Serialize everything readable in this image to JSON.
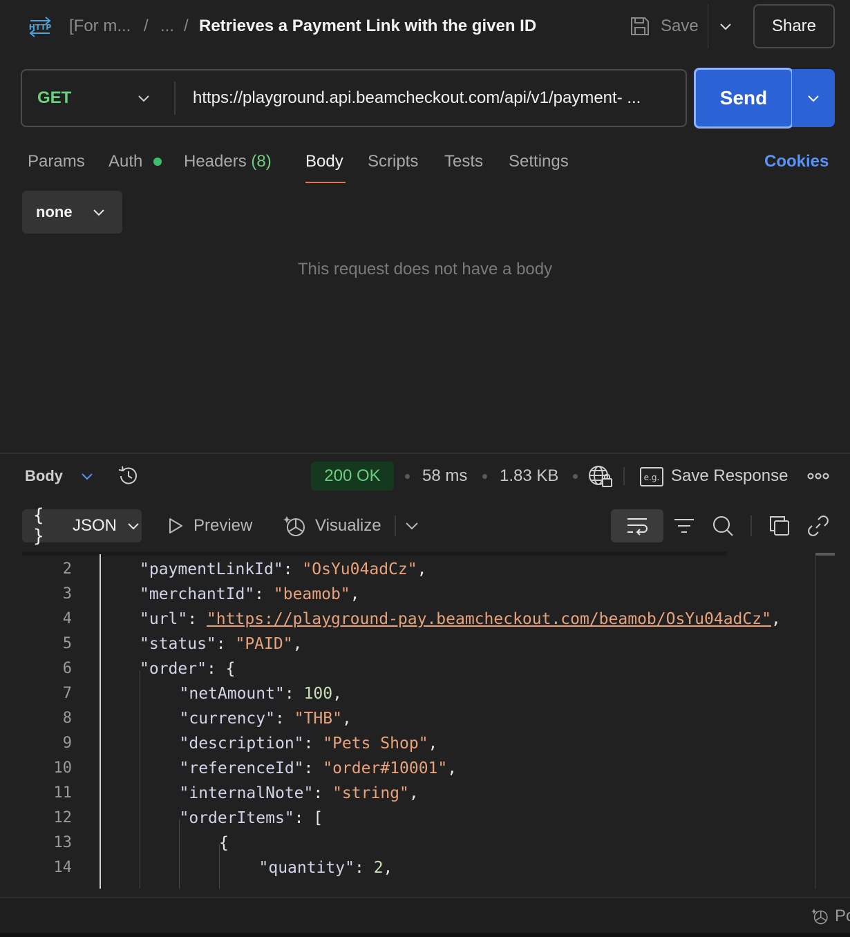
{
  "header": {
    "icon_label": "HTTP",
    "breadcrumb_collection": "[For m...",
    "breadcrumb_sep1": "/",
    "breadcrumb_folder": "...",
    "breadcrumb_sep2": "/",
    "title": "Retrieves a Payment Link with the given ID",
    "save_label": "Save",
    "share_label": "Share"
  },
  "request": {
    "method": "GET",
    "url": "https://playground.api.beamcheckout.com/api/v1/payment- ...",
    "send_label": "Send"
  },
  "tabs": {
    "params": "Params",
    "auth": "Auth",
    "headers": "Headers",
    "headers_count": "(8)",
    "body": "Body",
    "scripts": "Scripts",
    "tests": "Tests",
    "settings": "Settings",
    "cookies": "Cookies",
    "active": "Body"
  },
  "body": {
    "type": "none",
    "empty_message": "This request does not have a body"
  },
  "response": {
    "section_label": "Body",
    "status": "200 OK",
    "time": "58 ms",
    "size": "1.83 KB",
    "save_response": "Save Response",
    "eg_label": "e.g.",
    "format": "JSON",
    "format_icon": "{ }",
    "preview": "Preview",
    "visualize": "Visualize",
    "code_lines": [
      {
        "n": "2",
        "key": "\"paymentLinkId\"",
        "val": "\"OsYu04adCz\"",
        "vt": "s",
        "tail": ","
      },
      {
        "n": "3",
        "key": "\"merchantId\"",
        "val": "\"beamob\"",
        "vt": "s",
        "tail": ","
      },
      {
        "n": "4",
        "key": "\"url\"",
        "val": "\"https://playground-pay.beamcheckout.com/beamob/OsYu04adCz\"",
        "vt": "u",
        "tail": ","
      },
      {
        "n": "5",
        "key": "\"status\"",
        "val": "\"PAID\"",
        "vt": "s",
        "tail": ","
      },
      {
        "n": "6",
        "key": "\"order\"",
        "val": "{",
        "vt": "p",
        "tail": ""
      },
      {
        "n": "7",
        "key": "\"netAmount\"",
        "val": "100",
        "vt": "n",
        "tail": ","
      },
      {
        "n": "8",
        "key": "\"currency\"",
        "val": "\"THB\"",
        "vt": "s",
        "tail": ","
      },
      {
        "n": "9",
        "key": "\"description\"",
        "val": "\"Pets Shop\"",
        "vt": "s",
        "tail": ","
      },
      {
        "n": "10",
        "key": "\"referenceId\"",
        "val": "\"order#10001\"",
        "vt": "s",
        "tail": ","
      },
      {
        "n": "11",
        "key": "\"internalNote\"",
        "val": "\"string\"",
        "vt": "s",
        "tail": ","
      },
      {
        "n": "12",
        "key": "\"orderItems\"",
        "val": "[",
        "vt": "p",
        "tail": ""
      },
      {
        "n": "13",
        "key": "",
        "val": "{",
        "vt": "p",
        "tail": ""
      },
      {
        "n": "14",
        "key": "\"quantity\"",
        "val": "2",
        "vt": "n",
        "tail": ","
      }
    ]
  },
  "footer": {
    "item_label": "Po"
  },
  "colors": {
    "accent_blue": "#2b63d6",
    "method_green": "#6ccf7f",
    "active_tab_underline": "#e8704a",
    "status_bg": "#14391f"
  }
}
